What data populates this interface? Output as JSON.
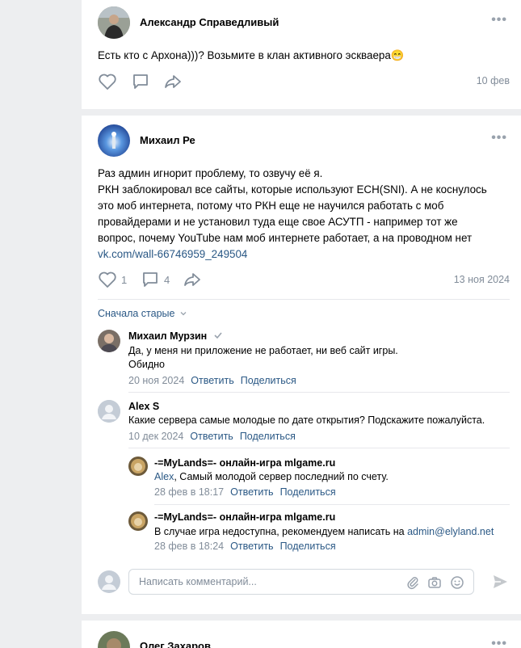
{
  "post1": {
    "author": "Александр Справедливый",
    "text": "Есть кто с Архона)))? Возьмите в клан активного эскваера😁",
    "date": "10 фев"
  },
  "post2": {
    "author": "Михаил Ре",
    "text_lines": [
      "Раз админ игнорит проблему, то озвучу её я.",
      "РКН заблокировал все сайты, которые используют ECH(SNI). А не коснулось",
      "это моб интернета, потому что РКН еще не научился работать с моб",
      "провайдерами и не установил туда еще свое АСУТП - например тот же",
      "вопрос, почему YouTube нам моб интернете работает, а на проводном нет"
    ],
    "link": "vk.com/wall-66746959_249504",
    "likes": "1",
    "comments": "4",
    "date": "13 ноя 2024",
    "sort_label": "Сначала старые",
    "comments_list": [
      {
        "author": "Михаил Мурзин",
        "lines": [
          "Да, у меня ни приложение не работает, ни веб сайт игры.",
          "Обидно"
        ],
        "date": "20 ноя 2024",
        "reply": "Ответить",
        "share": "Поделиться"
      },
      {
        "author": "Alex S",
        "lines": [
          "Какие сервера самые молодые по дате открытия? Подскажите пожалуйста."
        ],
        "date": "10 дек 2024",
        "reply": "Ответить",
        "share": "Поделиться"
      }
    ],
    "replies": [
      {
        "author": "-=MyLands=- онлайн-игра mlgame.ru",
        "mention": "Alex",
        "text": ", Самый молодой сервер последний по счету.",
        "date": "28 фев в 18:17",
        "reply": "Ответить",
        "share": "Поделиться"
      },
      {
        "author": "-=MyLands=- онлайн-игра mlgame.ru",
        "text": "В случае игра недоступна, рекомендуем написать на ",
        "email": "admin@elyland.net",
        "date": "28 фев в 18:24",
        "reply": "Ответить",
        "share": "Поделиться"
      }
    ],
    "input_placeholder": "Написать комментарий..."
  },
  "post3": {
    "author": "Олег Захаров"
  },
  "icons": {
    "more": "more-horizontal-icon",
    "like": "heart-icon",
    "comment": "comment-icon",
    "share": "share-arrow-icon",
    "verified": "check-icon",
    "attach": "paperclip-icon",
    "camera": "camera-icon",
    "emoji": "smile-icon",
    "send": "send-icon"
  },
  "colors": {
    "link": "#2a5885",
    "secondary": "#818c99",
    "background": "#edeef0"
  }
}
